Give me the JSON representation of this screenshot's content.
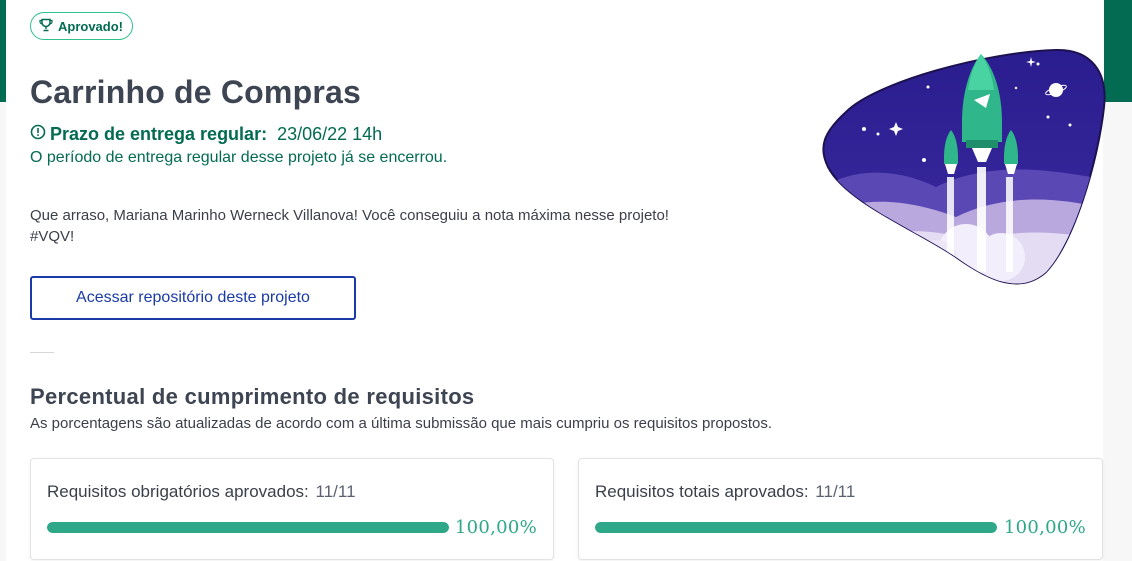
{
  "badge": {
    "label": "Aprovado!",
    "icon": "trophy-icon"
  },
  "project": {
    "title": "Carrinho de Compras",
    "deadline_label": "Prazo de entrega regular:",
    "deadline_date": "23/06/22 14h",
    "deadline_icon": "alert-circle-icon",
    "period_message": "O período de entrega regular desse projeto já se encerrou.",
    "message_line1": "Que arraso, Mariana Marinho Werneck Villanova! Você conseguiu a nota máxima nesse projeto!",
    "message_line2": "#VQV!",
    "repo_button": "Acessar repositório deste projeto"
  },
  "requirements": {
    "title": "Percentual de cumprimento de requisitos",
    "subtitle": "As porcentagens são atualizadas de acordo com a última submissão que mais cumpriu os requisitos propostos.",
    "cards": [
      {
        "label": "Requisitos obrigatórios aprovados:",
        "count": "11/11",
        "percent_text": "100,00%",
        "progress": 1.0
      },
      {
        "label": "Requisitos totais aprovados:",
        "count": "11/11",
        "percent_text": "100,00%",
        "progress": 1.0
      }
    ]
  },
  "colors": {
    "brand_green": "#036b52",
    "accent_green": "#2fc18c",
    "progress_green": "#2fa88a",
    "button_blue": "#1a3aa8",
    "illustration_purple": "#2d1c8c"
  }
}
